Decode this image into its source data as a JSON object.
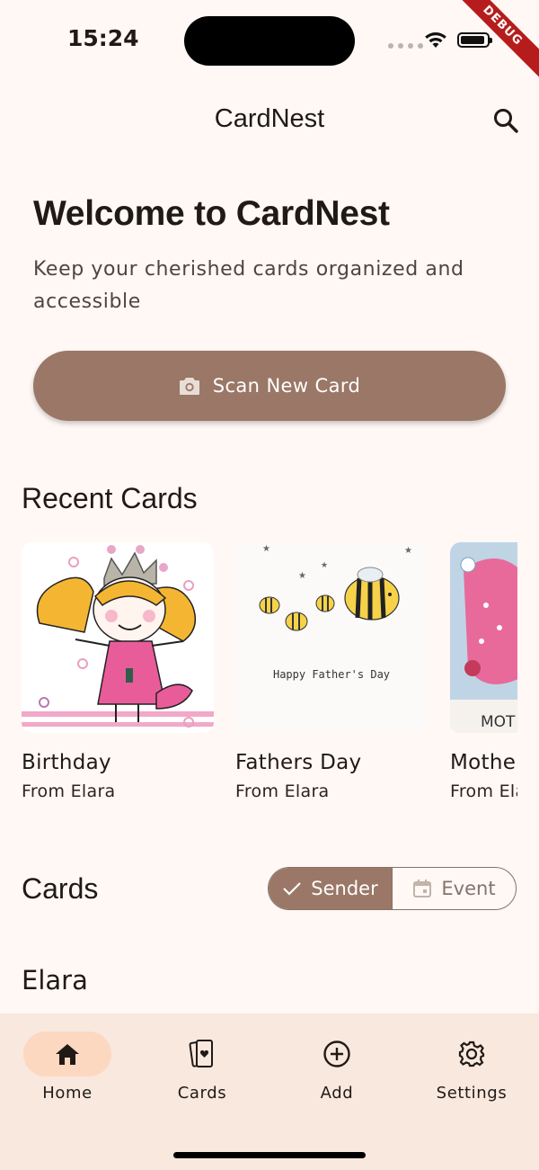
{
  "status_bar": {
    "time": "15:24",
    "debug_banner": "DEBUG"
  },
  "app_bar": {
    "title": "CardNest",
    "search_icon": "search-icon"
  },
  "hero": {
    "title": "Welcome to CardNest",
    "subtitle": "Keep your cherished cards organized and accessible",
    "scan_button_label": "Scan New Card",
    "scan_button_icon": "camera-icon"
  },
  "recent": {
    "title": "Recent Cards",
    "cards": [
      {
        "title": "Birthday",
        "from": "From Elara"
      },
      {
        "title": "Fathers Day",
        "from": "From Elara",
        "card_text": "Happy Father's Day"
      },
      {
        "title": "Mothers Day",
        "from": "From Elara",
        "card_text": "MOT"
      }
    ]
  },
  "cards_section": {
    "title": "Cards",
    "toggle": [
      {
        "label": "Sender",
        "icon": "check-icon",
        "selected": true
      },
      {
        "label": "Event",
        "icon": "calendar-icon",
        "selected": false
      }
    ],
    "group_title": "Elara"
  },
  "bottom_nav": {
    "items": [
      {
        "label": "Home",
        "icon": "home-icon",
        "active": true
      },
      {
        "label": "Cards",
        "icon": "cards-icon",
        "active": false
      },
      {
        "label": "Add",
        "icon": "add-circle-icon",
        "active": false
      },
      {
        "label": "Settings",
        "icon": "gear-icon",
        "active": false
      }
    ]
  },
  "colors": {
    "background": "#FFF8F5",
    "primary": "#9A7767",
    "nav_background": "#F8E8DE",
    "nav_active_pill": "#FDD8C0",
    "text": "#201A17"
  }
}
